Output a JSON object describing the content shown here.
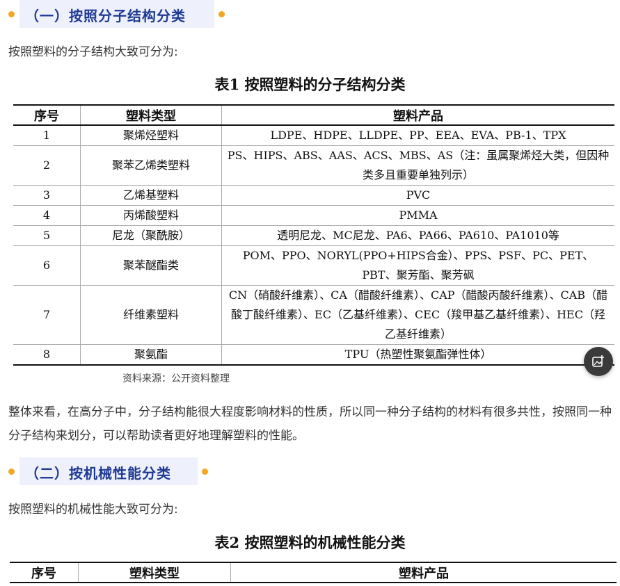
{
  "section1": {
    "heading": "（一）按照分子结构分类"
  },
  "intro1": "按照塑料的分子结构大致可分为:",
  "table1": {
    "caption": "表1 按照塑料的分子结构分类",
    "headers": [
      "序号",
      "塑料类型",
      "塑料产品"
    ],
    "rows": [
      {
        "no": "1",
        "type": "聚烯烃塑料",
        "products": "LDPE、HDPE、LLDPE、PP、EEA、EVA、PB-1、TPX"
      },
      {
        "no": "2",
        "type": "聚苯乙烯类塑料",
        "products": "PS、HIPS、ABS、AAS、ACS、MBS、AS（注：虽属聚烯烃大类，但因种类多且重要单独列示）"
      },
      {
        "no": "3",
        "type": "乙烯基塑料",
        "products": "PVC"
      },
      {
        "no": "4",
        "type": "丙烯酸塑料",
        "products": "PMMA"
      },
      {
        "no": "5",
        "type": "尼龙（聚酰胺）",
        "products": "透明尼龙、MC尼龙、PA6、PA66、PA610、PA1010等"
      },
      {
        "no": "6",
        "type": "聚苯醚酯类",
        "products": "POM、PPO、NORYL(PPO+HIPS合金）、PPS、PSF、PC、PET、PBT、聚芳酯、聚芳砜"
      },
      {
        "no": "7",
        "type": "纤维素塑料",
        "products": "CN（硝酸纤维素）、CA（醋酸纤维素）、CAP（醋酸丙酸纤维素）、CAB（醋酸丁酸纤维素）、EC（乙基纤维素）、CEC（羧甲基乙基纤维素）、HEC（羟乙基纤维素）"
      },
      {
        "no": "8",
        "type": "聚氨酯",
        "products": "TPU（热塑性聚氨酯弹性体）"
      }
    ],
    "source": "资料来源：公开资料整理"
  },
  "summary": "整体来看，在高分子中，分子结构能很大程度影响材料的性质，所以同一种分子结构的材料有很多共性，按照同一种分子结构来划分，可以帮助读者更好地理解塑料的性能。",
  "section2": {
    "heading": "（二）按机械性能分类"
  },
  "intro2": "按照塑料的机械性能大致可分为:",
  "table2": {
    "caption": "表2 按照塑料的机械性能分类",
    "headers": [
      "序号",
      "塑料类型",
      "塑料产品"
    ]
  },
  "colors": {
    "accent_dot": "#f5a623",
    "heading_text": "#1f3a93",
    "heading_bg": "#eef1fb"
  },
  "icons": {
    "floating_button": "image-edit-icon"
  }
}
